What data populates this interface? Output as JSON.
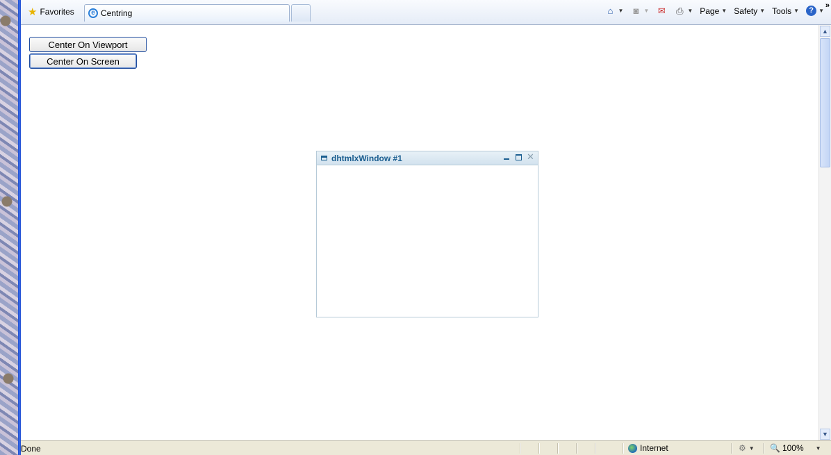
{
  "browser": {
    "favorites_label": "Favorites",
    "tab_title": "Centring",
    "toolbar": {
      "page_label": "Page",
      "safety_label": "Safety",
      "tools_label": "Tools",
      "overflow": "»",
      "icons": [
        "home-icon",
        "feeds-icon",
        "mail-icon",
        "print-icon",
        "help-icon"
      ]
    }
  },
  "page": {
    "buttons": {
      "center_viewport": "Center On Viewport",
      "center_screen": "Center On Screen"
    },
    "dhtmlx_window": {
      "title": "dhtmlxWindow #1"
    }
  },
  "statusbar": {
    "text": "Done",
    "zone": "Internet",
    "zoom": "100%"
  },
  "colors": {
    "window_title": "#1b5e90",
    "button_border": "#1f4c9e",
    "frame_blue": "#1d4bd1"
  }
}
